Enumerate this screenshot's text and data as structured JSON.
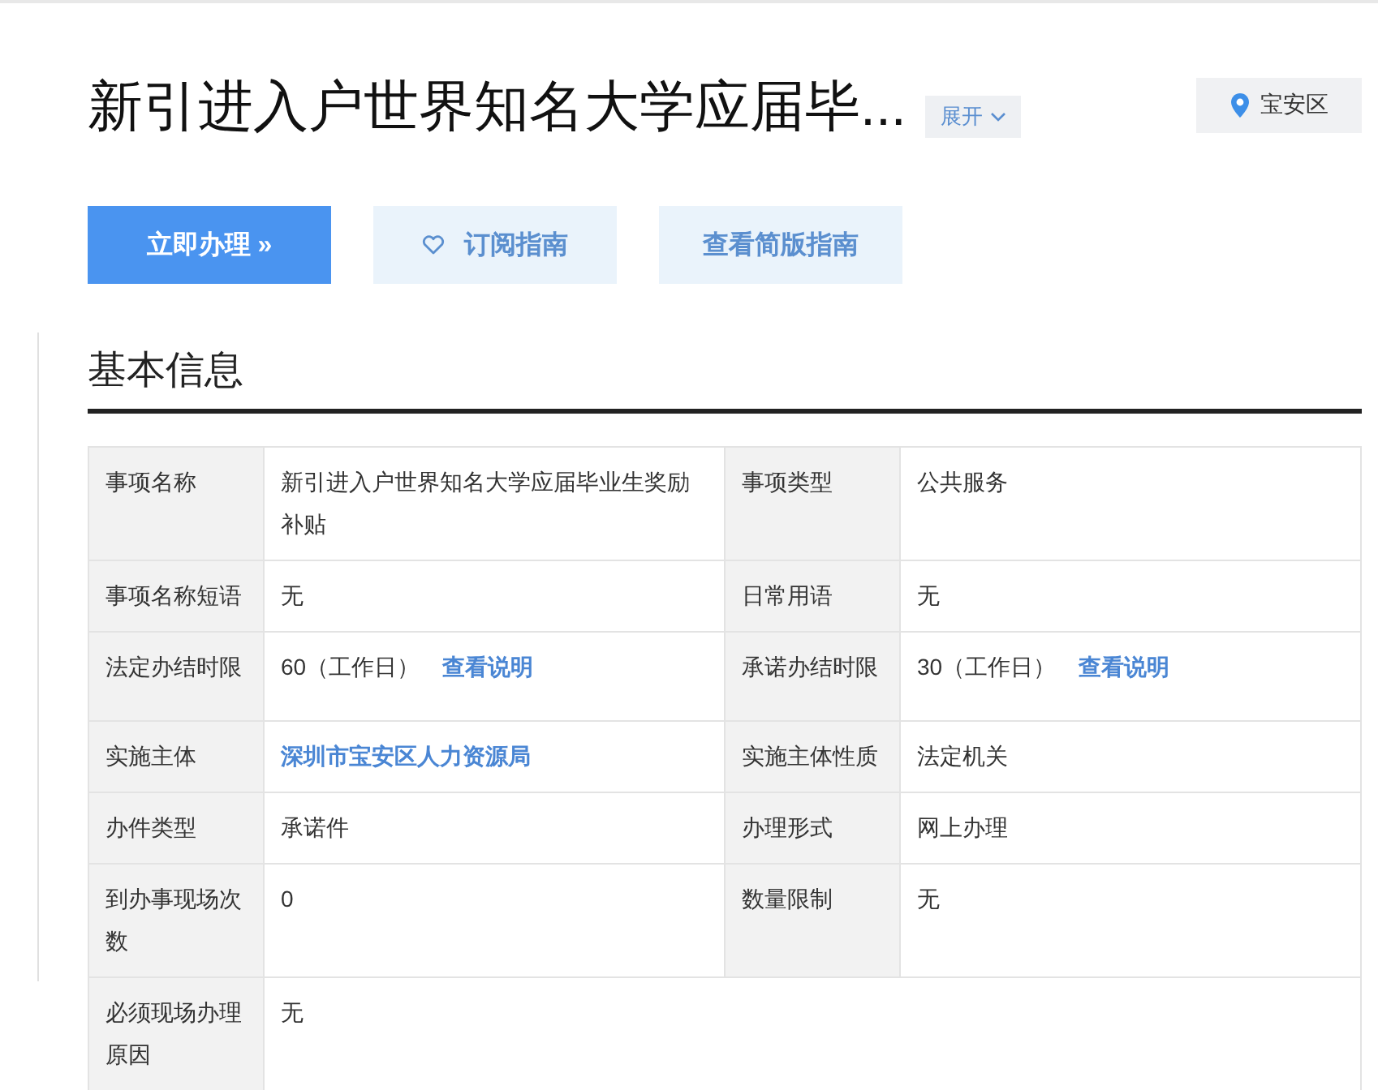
{
  "header": {
    "title": "新引进入户世界知名大学应届毕...",
    "expand_label": "展开",
    "location": "宝安区"
  },
  "actions": [
    {
      "kind": "primary",
      "label": "立即办理 »"
    },
    {
      "kind": "subscribe",
      "label": "订阅指南"
    },
    {
      "kind": "secondary",
      "label": "查看简版指南"
    }
  ],
  "section_title": "基本信息",
  "rows": [
    [
      {
        "label": "事项名称",
        "value": "新引进入户世界知名大学应届毕业生奖励补贴"
      },
      {
        "label": "事项类型",
        "value": "公共服务"
      }
    ],
    [
      {
        "label": "事项名称短语",
        "value": "无"
      },
      {
        "label": "日常用语",
        "value": "无"
      }
    ],
    [
      {
        "label": "法定办结时限",
        "value": "60（工作日）",
        "link": "查看说明"
      },
      {
        "label": "承诺办结时限",
        "value": "30（工作日）",
        "link": "查看说明"
      }
    ],
    [
      {
        "label": "实施主体",
        "link": "深圳市宝安区人力资源局"
      },
      {
        "label": "实施主体性质",
        "value": "法定机关"
      }
    ],
    [
      {
        "label": "办件类型",
        "value": "承诺件"
      },
      {
        "label": "办理形式",
        "value": "网上办理"
      }
    ],
    [
      {
        "label": "到办事现场次数",
        "value": "0"
      },
      {
        "label": "数量限制",
        "value": "无"
      }
    ],
    [
      {
        "label": "必须现场办理原因",
        "value": "无"
      }
    ]
  ]
}
